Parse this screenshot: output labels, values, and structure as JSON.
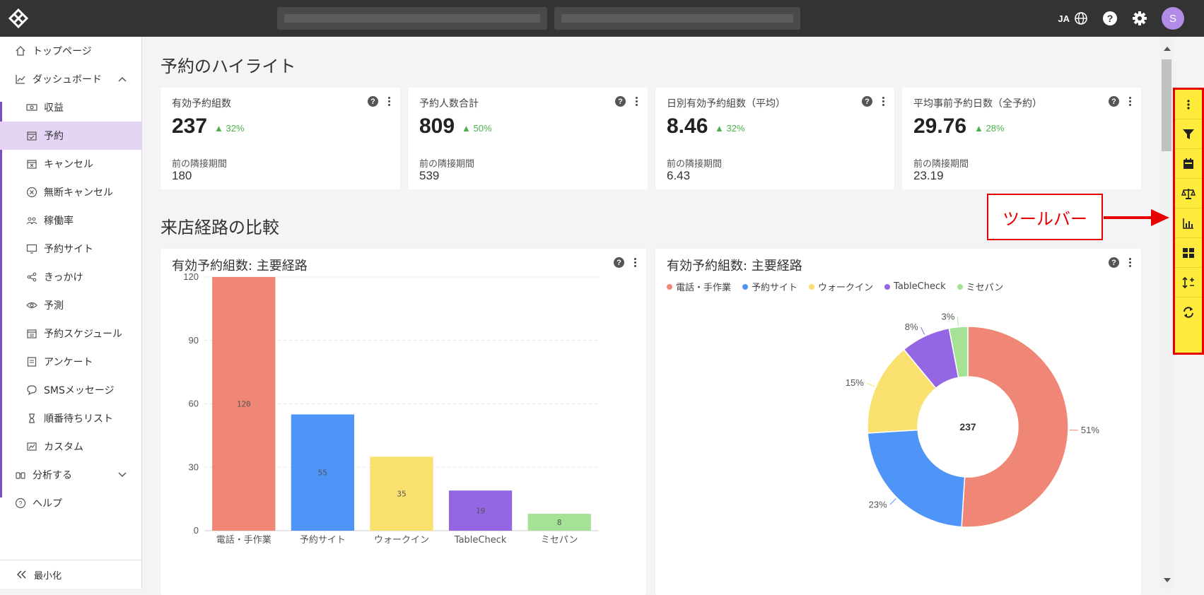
{
  "topbar": {
    "lang": "JA",
    "avatar_initial": "S"
  },
  "sidebar": {
    "top": "トップページ",
    "dashboard": "ダッシュボード",
    "items": [
      {
        "label": "収益"
      },
      {
        "label": "予約"
      },
      {
        "label": "キャンセル"
      },
      {
        "label": "無断キャンセル"
      },
      {
        "label": "稼働率"
      },
      {
        "label": "予約サイト"
      },
      {
        "label": "きっかけ"
      },
      {
        "label": "予測"
      },
      {
        "label": "予約スケジュール"
      },
      {
        "label": "アンケート"
      },
      {
        "label": "SMSメッセージ"
      },
      {
        "label": "順番待ちリスト"
      },
      {
        "label": "カスタム"
      }
    ],
    "analyze": "分析する",
    "help": "ヘルプ",
    "minimize": "最小化"
  },
  "highlights": {
    "title": "予約のハイライト",
    "cards": [
      {
        "title": "有効予約組数",
        "value": "237",
        "delta": "32%",
        "prev_label": "前の隣接期間",
        "prev_value": "180"
      },
      {
        "title": "予約人数合計",
        "value": "809",
        "delta": "50%",
        "prev_label": "前の隣接期間",
        "prev_value": "539"
      },
      {
        "title": "日別有効予約組数（平均）",
        "value": "8.46",
        "delta": "32%",
        "prev_label": "前の隣接期間",
        "prev_value": "6.43"
      },
      {
        "title": "平均事前予約日数（全予約）",
        "value": "29.76",
        "delta": "28%",
        "prev_label": "前の隣接期間",
        "prev_value": "23.19"
      }
    ]
  },
  "comparison": {
    "title": "来店経路の比較"
  },
  "toolbar_callout": "ツールバー",
  "colors": {
    "phone": "#ef8676",
    "site": "#4f94f7",
    "walkin": "#fae06e",
    "tablecheck": "#9466e3",
    "misepan": "#a6e296"
  },
  "chart_data": [
    {
      "type": "bar",
      "title": "有効予約組数: 主要経路",
      "categories": [
        "電話・手作業",
        "予約サイト",
        "ウォークイン",
        "TableCheck",
        "ミセパン"
      ],
      "values": [
        120,
        55,
        35,
        19,
        8
      ],
      "ylim": [
        0,
        120
      ],
      "yticks": [
        0,
        30,
        60,
        90,
        120
      ],
      "grid": true
    },
    {
      "type": "pie",
      "title": "有効予約組数: 主要経路",
      "labels": [
        "電話・手作業",
        "予約サイト",
        "ウォークイン",
        "TableCheck",
        "ミセパン"
      ],
      "values": [
        51,
        23,
        15,
        8,
        3
      ],
      "value_labels": [
        "51%",
        "23%",
        "15%",
        "8%",
        "3%"
      ],
      "center_total": "237",
      "legend": "top-left"
    }
  ]
}
